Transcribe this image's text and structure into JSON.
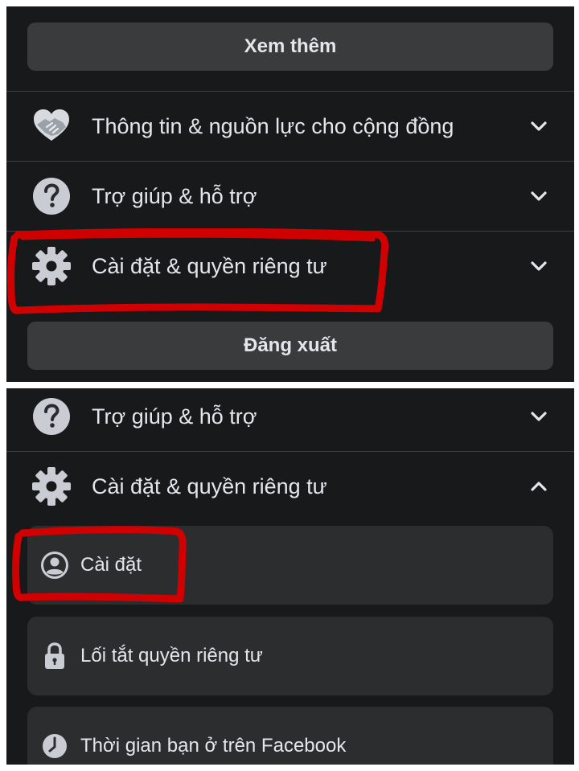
{
  "top_panel": {
    "see_more_label": "Xem thêm",
    "menu": [
      {
        "label": "Thông tin & nguồn lực cho cộng đồng",
        "icon": "heart-hands-icon",
        "expanded": false
      },
      {
        "label": "Trợ giúp & hỗ trợ",
        "icon": "question-icon",
        "expanded": false
      },
      {
        "label": "Cài đặt & quyền riêng tư",
        "icon": "gear-icon",
        "expanded": false
      }
    ],
    "logout_label": "Đăng xuất"
  },
  "bottom_panel": {
    "menu": [
      {
        "label": "Trợ giúp & hỗ trợ",
        "icon": "question-icon",
        "expanded": false
      },
      {
        "label": "Cài đặt & quyền riêng tư",
        "icon": "gear-icon",
        "expanded": true
      }
    ],
    "submenu": [
      {
        "label": "Cài đặt",
        "icon": "user-circle-icon"
      },
      {
        "label": "Lối tắt quyền riêng tư",
        "icon": "lock-icon"
      },
      {
        "label": "Thời gian bạn ở trên Facebook",
        "icon": "clock-icon"
      }
    ]
  },
  "colors": {
    "background": "#18191a",
    "button": "#3a3b3c",
    "card": "#2c2d2f",
    "text": "#e4e6eb",
    "annotation": "#d00000"
  }
}
